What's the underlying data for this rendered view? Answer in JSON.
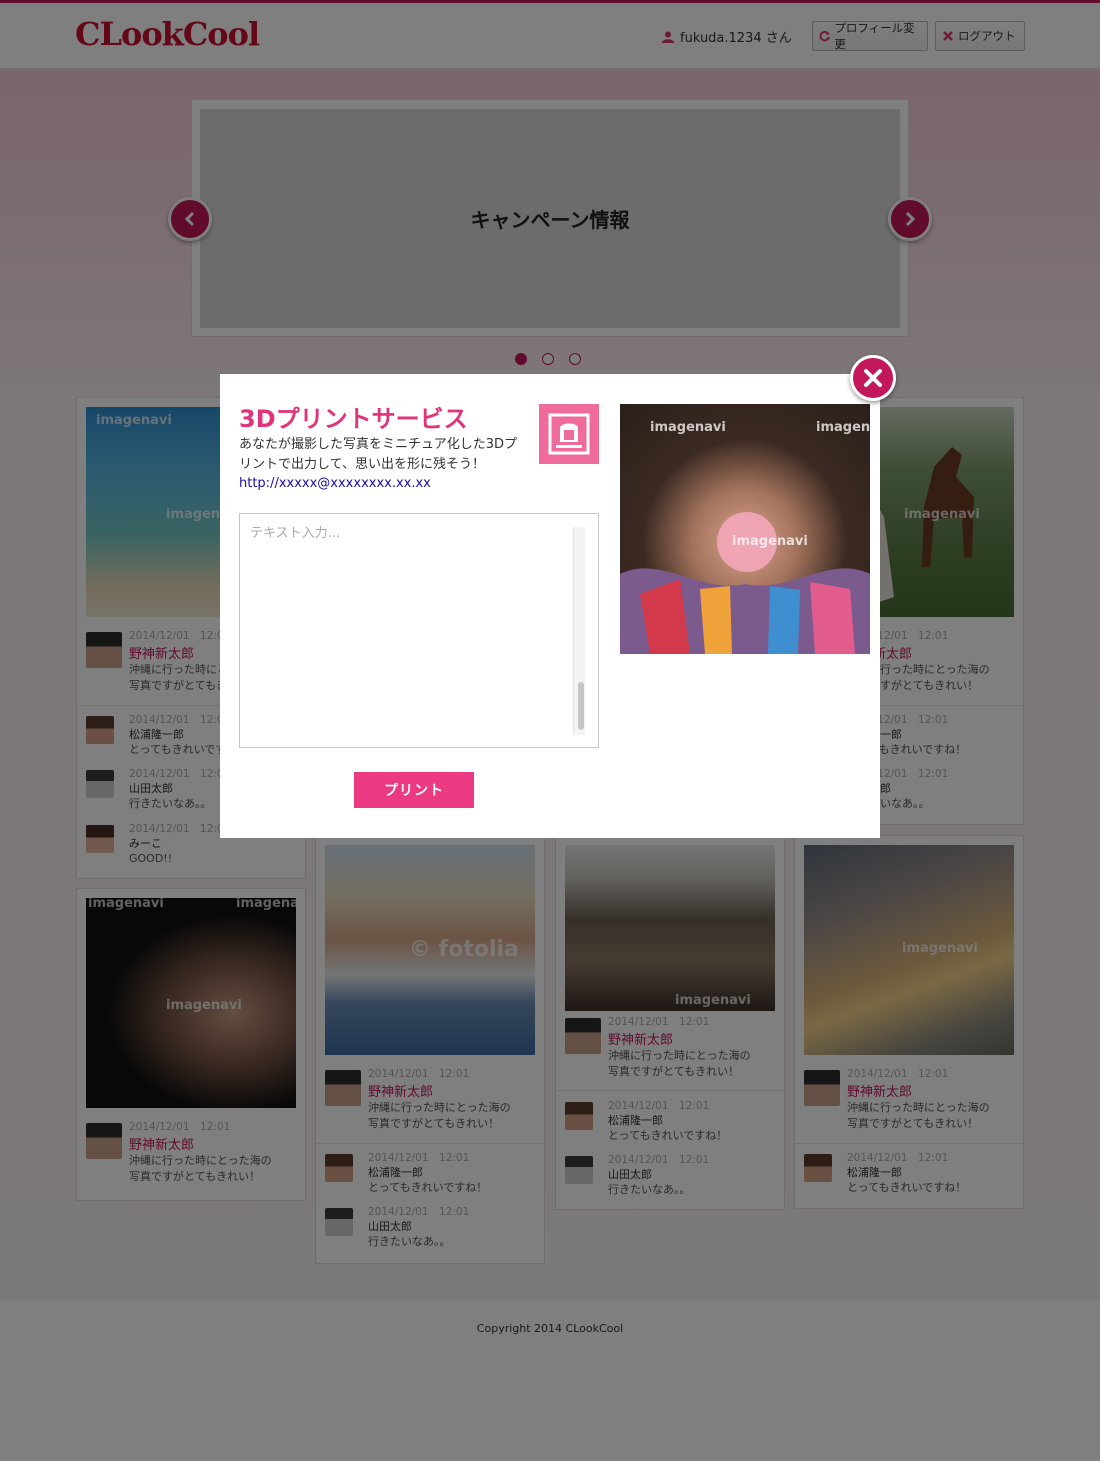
{
  "header": {
    "logo": "CLookCool",
    "user_name": "fukuda.1234 さん",
    "profile_button": "プロフィール変更",
    "logout_button": "ログアウト"
  },
  "banner": {
    "title": "キャンペーン情報",
    "slides_total": 3,
    "active_slide": 1
  },
  "watermark": "imagenavi",
  "watermark_fotolia": "© fotolia",
  "cards": [
    {
      "posts": [
        {
          "date": "2014/12/01",
          "time": "12:01",
          "name": "野神新太郎",
          "text1": "沖縄に行った時にとった海の",
          "text2": "写真ですがとてもきれい！"
        },
        {
          "date": "2014/12/01",
          "time": "12:01",
          "name": "松浦隆一郎",
          "text1": "とってもきれいですね！"
        },
        {
          "date": "2014/12/01",
          "time": "12:01",
          "name": "山田太郎",
          "text1": "行きたいなあ。。"
        },
        {
          "date": "2014/12/01",
          "time": "12:01",
          "name": "みーこ",
          "text1": "GOOD!!"
        }
      ]
    },
    {
      "posts": [
        {
          "date": "2014/12/01",
          "time": "12:01",
          "name": "野神新太郎",
          "text1": "沖縄に行った時にとった海の",
          "text2": "写真ですがとてもきれい！"
        },
        {
          "date": "2014/12/01",
          "time": "12:01",
          "name": "松浦隆一郎",
          "text1": "とってもきれいですね！"
        },
        {
          "date": "2014/12/01",
          "time": "12:01",
          "name": "山田太郎",
          "text1": "行きたいなあ。。"
        }
      ]
    },
    {
      "posts": [
        {
          "date": "2014/12/01",
          "time": "12:01",
          "name": "野神新太郎",
          "text1": "沖縄に行った時にとった海の",
          "text2": "写真ですがとてもきれい！"
        }
      ]
    },
    {
      "posts": [
        {
          "date": "2014/12/01",
          "time": "12:01",
          "name": "野神新太郎",
          "text1": "沖縄に行った時にとった海の",
          "text2": "写真ですがとてもきれい！"
        },
        {
          "date": "2014/12/01",
          "time": "12:01",
          "name": "松浦隆一郎",
          "text1": "とってもきれいですね！"
        },
        {
          "date": "2014/12/01",
          "time": "12:01",
          "name": "山田太郎",
          "text1": "行きたいなあ。。"
        }
      ]
    },
    {
      "posts": [
        {
          "date": "2014/12/01",
          "time": "12:01",
          "name": "野神新太郎",
          "text1": "沖縄に行った時にとった海の",
          "text2": "写真ですがとてもきれい！"
        },
        {
          "date": "2014/12/01",
          "time": "12:01",
          "name": "松浦隆一郎",
          "text1": "とってもきれいですね！"
        },
        {
          "date": "2014/12/01",
          "time": "12:01",
          "name": "山田太郎",
          "text1": "行きたいなあ。。"
        }
      ]
    },
    {
      "posts": [
        {
          "date": "2014/12/01",
          "time": "12:01",
          "name": "野神新太郎",
          "text1": "沖縄に行った時にとった海の",
          "text2": "写真ですがとてもきれい！"
        },
        {
          "date": "2014/12/01",
          "time": "12:01",
          "name": "松浦隆一郎",
          "text1": "とってもきれいですね！"
        }
      ]
    }
  ],
  "footer": {
    "copyright": "Copyright 2014 CLookCool"
  },
  "modal": {
    "title": "3Dプリントサービス",
    "description": "あなたが撮影した写真をミニチュア化した3Dプリントで出力して、思い出を形に残そう！",
    "link": "http://xxxxx@xxxxxxxx.xx.xx",
    "textarea_placeholder": "テキスト入力...",
    "print_button": "プリント"
  },
  "colors": {
    "brand": "#c2185b",
    "accent_pink": "#ec3a82",
    "link_blue": "#1a0dab"
  },
  "icons": {
    "user": "user-icon",
    "profile": "refresh-icon",
    "logout": "close-x-icon",
    "prev": "chevron-left-icon",
    "next": "chevron-right-icon",
    "modal_close": "close-icon",
    "print_service": "print-frame-icon"
  }
}
